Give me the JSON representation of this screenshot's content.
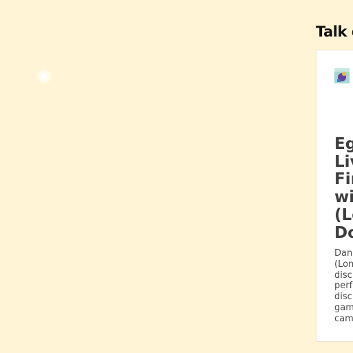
{
  "talk_section": {
    "title": "Talk of the Town"
  },
  "featured_article": {
    "thumbnail_icon": "article-thumbnail-icon",
    "headline": "Egg Live Fin wit (Lo Do",
    "excerpt": "Dan (Lon disc perf disc gam cam"
  },
  "colors": {
    "page_background": "#fff5d6",
    "card_background": "#ffffff",
    "headline_text": "#3d3d3d"
  }
}
